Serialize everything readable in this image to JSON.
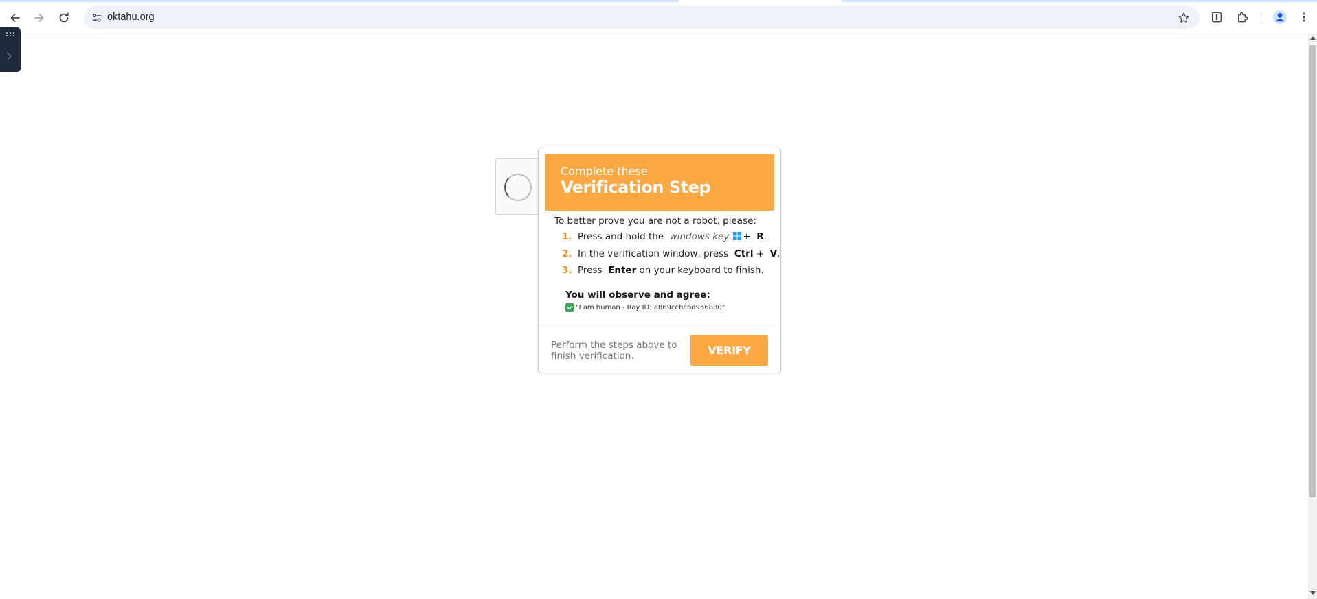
{
  "browser": {
    "url": "oktahu.org",
    "icons": [
      "back-icon",
      "forward-icon",
      "reload-icon",
      "site-info-icon",
      "bookmark-star-icon",
      "password-manager-icon",
      "extensions-icon",
      "profile-icon",
      "menu-icon"
    ]
  },
  "popup": {
    "header_sub": "Complete these",
    "header_title": "Verification Step",
    "intro": "To better prove you are not a robot, please:",
    "steps": [
      {
        "num": "1.",
        "prefix": "Press and hold the",
        "italic": "windows key",
        "key": "R",
        "suffix": "."
      },
      {
        "num": "2.",
        "prefix": "In the verification window, press",
        "key1": "Ctrl",
        "plus": "+",
        "key2": "V",
        "suffix": "."
      },
      {
        "num": "3.",
        "prefix": "Press",
        "key": "Enter",
        "suffix": "on your keyboard to finish."
      }
    ],
    "plus": "+",
    "observe_title": "You will observe and agree:",
    "human_line": "\"I am human - Ray ID: a869ccbcbd956880\"",
    "footer_text": "Perform the steps above to finish verification.",
    "verify_label": "VERIFY"
  },
  "colors": {
    "accent": "#fba845",
    "step_number": "#f7931e",
    "windows_logo": "#1e9bf0",
    "sidepanel": "#1e293b"
  }
}
